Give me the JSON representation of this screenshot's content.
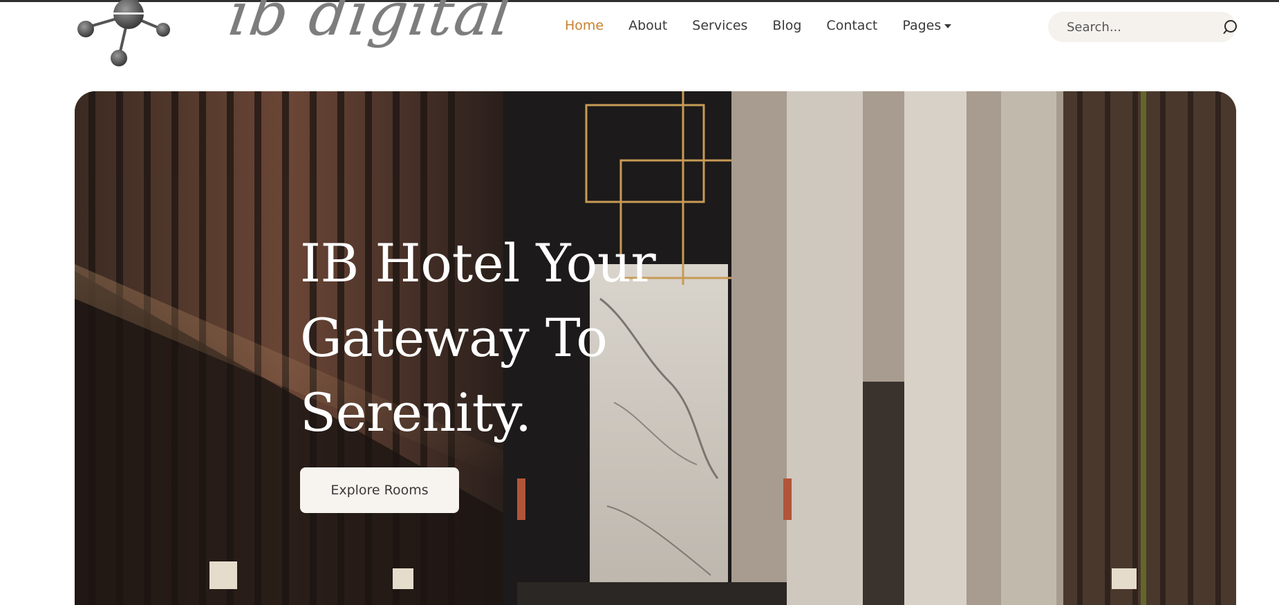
{
  "brand": {
    "name": "ib digital"
  },
  "nav": {
    "items": [
      {
        "label": "Home",
        "active": true
      },
      {
        "label": "About",
        "active": false
      },
      {
        "label": "Services",
        "active": false
      },
      {
        "label": "Blog",
        "active": false
      },
      {
        "label": "Contact",
        "active": false
      },
      {
        "label": "Pages",
        "active": false,
        "has_dropdown": true
      }
    ]
  },
  "search": {
    "placeholder": "Search...",
    "value": "",
    "icon": "search-icon"
  },
  "hero": {
    "title": "IB Hotel Your Gateway To Serenity.",
    "cta_label": "Explore Rooms"
  },
  "colors": {
    "accent": "#c8802f",
    "nav_text": "#3a3a3a",
    "search_bg": "#f5f2ee",
    "button_bg": "#f7f3ee"
  }
}
